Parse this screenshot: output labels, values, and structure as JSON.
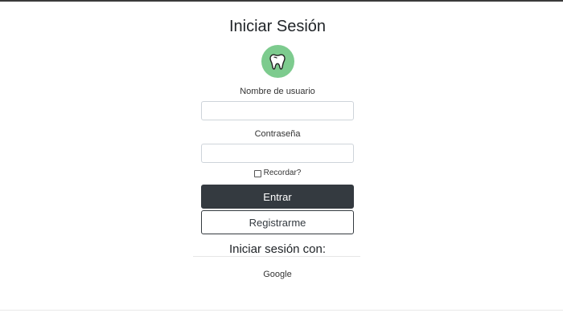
{
  "login": {
    "title": "Iniciar Sesión",
    "logo_icon": "tooth-icon",
    "username_label": "Nombre de usuario",
    "username_value": "",
    "password_label": "Contraseña",
    "password_value": "",
    "remember_label": "Recordar?",
    "remember_checked": false,
    "submit_label": "Entrar",
    "register_label": "Registrarme"
  },
  "social": {
    "title": "Iniciar sesión con:",
    "providers": [
      "Google"
    ]
  },
  "colors": {
    "logo_bg": "#7dcb8e",
    "primary_button": "#343a40",
    "top_bar": "#3a3a3a"
  }
}
